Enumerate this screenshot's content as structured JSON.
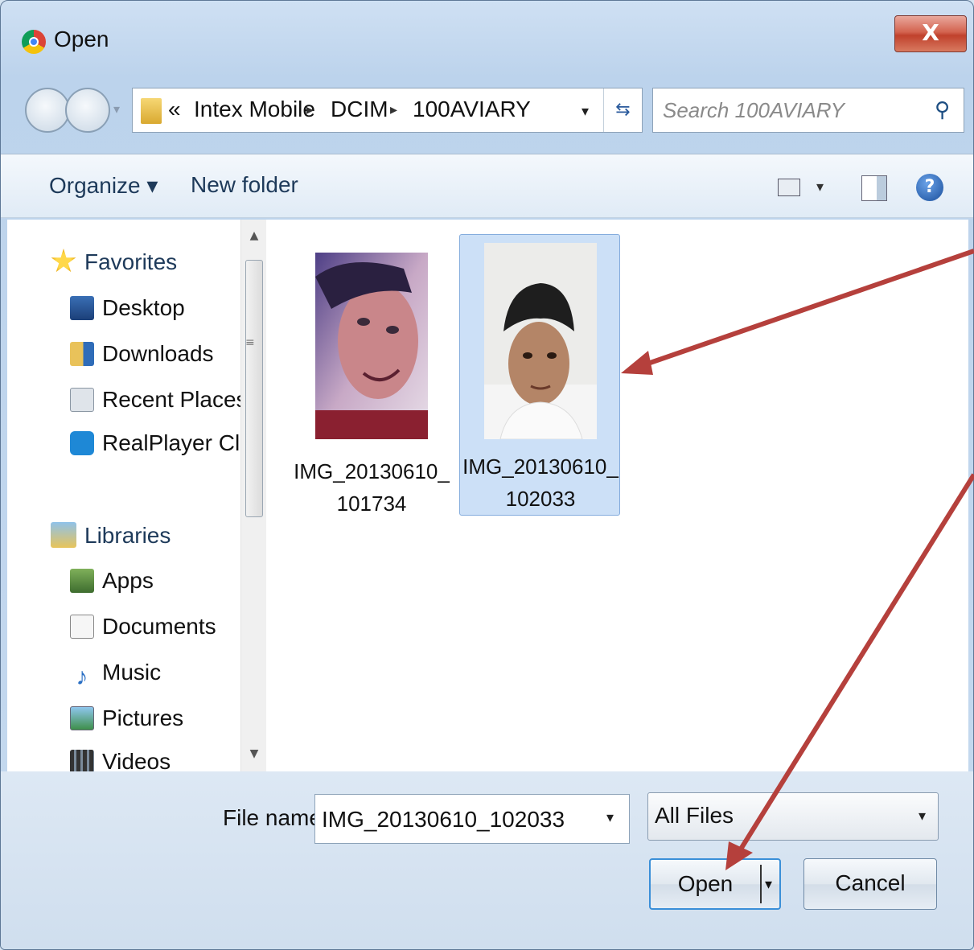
{
  "window": {
    "title": "Open",
    "close_label": "X"
  },
  "nav": {
    "breadcrumb": [
      "«",
      "Intex Mobile",
      "DCIM",
      "100AVIARY"
    ],
    "search_placeholder": "Search 100AVIARY"
  },
  "toolbar": {
    "organize": "Organize ▾",
    "new_folder": "New folder",
    "help": "?"
  },
  "navpane": {
    "favorites": {
      "label": "Favorites",
      "items": [
        "Desktop",
        "Downloads",
        "Recent Places",
        "RealPlayer Cloud"
      ]
    },
    "libraries": {
      "label": "Libraries",
      "items": [
        "Apps",
        "Documents",
        "Music",
        "Pictures",
        "Videos"
      ]
    }
  },
  "files": [
    {
      "name": "IMG_20130610_101734",
      "selected": false
    },
    {
      "name": "IMG_20130610_102033",
      "selected": true
    }
  ],
  "bottom": {
    "file_name_label": "File name:",
    "file_name_value": "IMG_20130610_102033",
    "filter": "All Files",
    "open": "Open",
    "cancel": "Cancel"
  },
  "colors": {
    "annotation_arrow": "#b5403c",
    "selection": "#cce0f7"
  }
}
